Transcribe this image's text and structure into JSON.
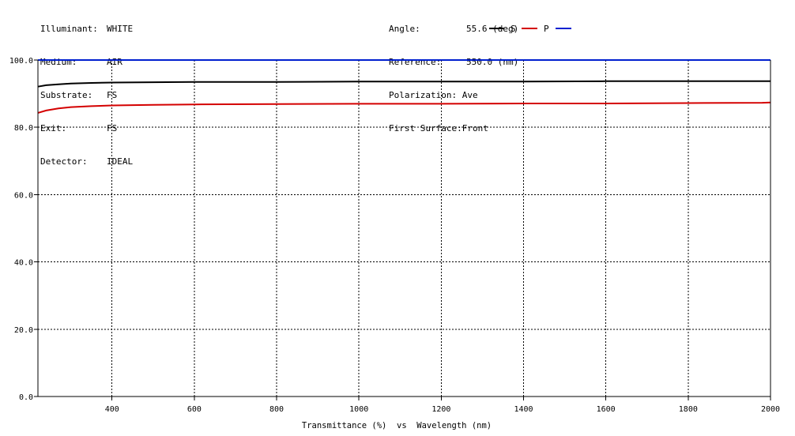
{
  "header_left": [
    {
      "key": "Illuminant:",
      "value": "WHITE"
    },
    {
      "key": "Medium:",
      "value": "AIR"
    },
    {
      "key": "Substrate:",
      "value": "FS"
    },
    {
      "key": "Exit:",
      "value": "FS"
    },
    {
      "key": "Detector:",
      "value": "IDEAL"
    }
  ],
  "header_right": [
    {
      "key": "Angle:",
      "value": "55.6 (deg)"
    },
    {
      "key": "Reference:",
      "value": "550.0 (nm)"
    },
    {
      "key": "Polarization:",
      "value": "Ave"
    },
    {
      "key": "First Surface:",
      "value": "Front"
    }
  ],
  "legend": [
    {
      "label": "S",
      "color": "#d40000"
    },
    {
      "label": "P",
      "color": "#0020d0"
    }
  ],
  "colors": {
    "ave": "#000000",
    "s": "#d40000",
    "p": "#0020d0",
    "grid": "#000000"
  },
  "chart_data": {
    "type": "line",
    "xlabel": "Transmittance (%)  vs  Wavelength (nm)",
    "ylabel": "",
    "xlim": [
      220,
      2000
    ],
    "ylim": [
      0,
      100
    ],
    "x_ticks": [
      400,
      600,
      800,
      1000,
      1200,
      1400,
      1600,
      1800,
      2000
    ],
    "x_tick_labels": [
      "400",
      "600",
      "800",
      "1000",
      "1200",
      "1400",
      "1600",
      "1800",
      "2000"
    ],
    "y_ticks": [
      0,
      20,
      40,
      60,
      80,
      100
    ],
    "y_tick_labels": [
      "0.0",
      "20.0",
      "40.0",
      "60.0",
      "80.0",
      "100.0"
    ],
    "grid": true,
    "series": [
      {
        "name": "Ave",
        "color": "#000000",
        "x": [
          220,
          240,
          270,
          300,
          350,
          400,
          500,
          600,
          800,
          1000,
          1200,
          1400,
          1600,
          1800,
          2000
        ],
        "y": [
          92.1,
          92.5,
          92.8,
          93.0,
          93.2,
          93.3,
          93.4,
          93.5,
          93.5,
          93.6,
          93.6,
          93.6,
          93.7,
          93.7,
          93.7
        ]
      },
      {
        "name": "S",
        "color": "#d40000",
        "x": [
          220,
          240,
          270,
          300,
          350,
          400,
          500,
          600,
          800,
          1000,
          1200,
          1400,
          1600,
          1800,
          1980,
          2000
        ],
        "y": [
          84.3,
          85.0,
          85.6,
          86.0,
          86.3,
          86.5,
          86.7,
          86.8,
          86.9,
          87.0,
          87.0,
          87.1,
          87.1,
          87.2,
          87.3,
          87.4
        ]
      },
      {
        "name": "P",
        "color": "#0020d0",
        "x": [
          220,
          2000
        ],
        "y": [
          100.0,
          100.0
        ]
      }
    ]
  }
}
